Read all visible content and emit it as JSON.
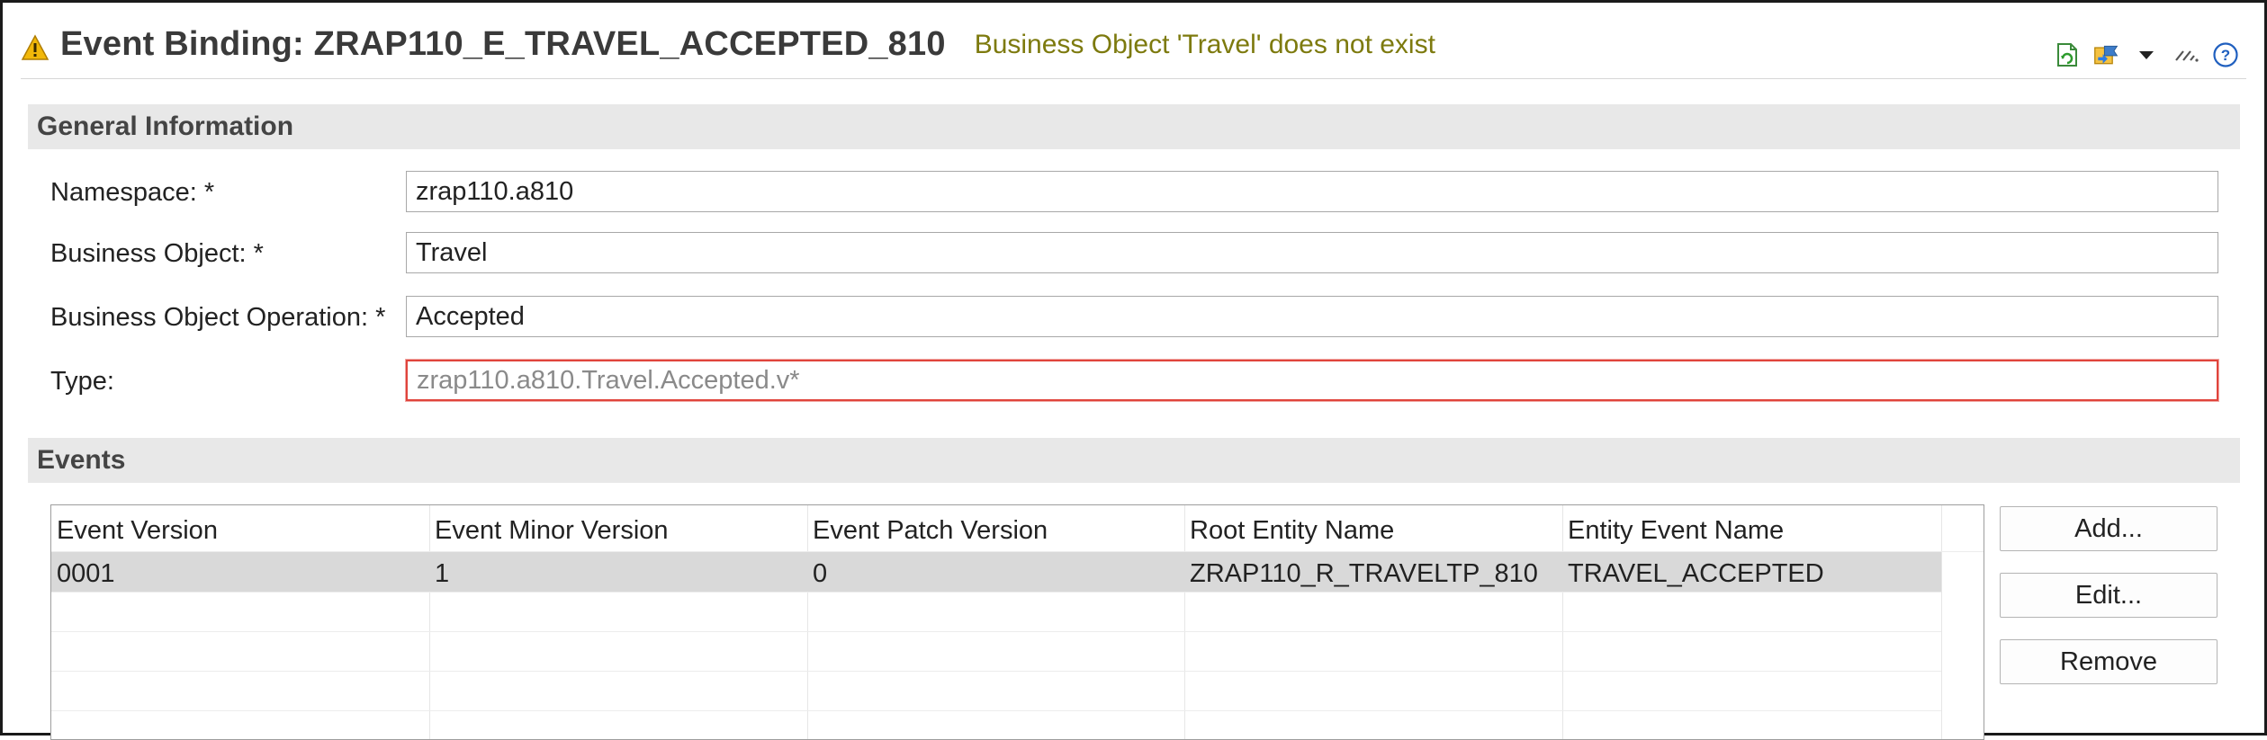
{
  "header": {
    "title": "Event Binding: ZRAP110_E_TRAVEL_ACCEPTED_810",
    "status_message": "Business Object 'Travel' does not exist",
    "status_color": "#7d7a0e",
    "warning_icon": "warning-icon",
    "toolbar_icons": [
      "refresh-document-icon",
      "publish-icon",
      "dropdown-arrow-icon",
      "link-icon",
      "help-icon"
    ]
  },
  "general": {
    "section_title": "General Information",
    "fields": [
      {
        "label": "Namespace: *",
        "value": "zrap110.a810",
        "placeholder": ""
      },
      {
        "label": "Business Object: *",
        "value": "Travel",
        "placeholder": ""
      },
      {
        "label": "Business Object Operation: *",
        "value": "Accepted",
        "placeholder": ""
      },
      {
        "label": "Type:",
        "value": "",
        "placeholder": "zrap110.a810.Travel.Accepted.v*",
        "error": true
      }
    ]
  },
  "events": {
    "section_title": "Events",
    "columns": [
      "Event Version",
      "Event Minor Version",
      "Event Patch Version",
      "Root Entity Name",
      "Entity Event Name"
    ],
    "rows": [
      [
        "0001",
        "1",
        "0",
        "ZRAP110_R_TRAVELTP_810",
        "TRAVEL_ACCEPTED"
      ]
    ],
    "buttons": {
      "add": "Add...",
      "edit": "Edit...",
      "remove": "Remove"
    }
  },
  "colors": {
    "error_border": "#e0443c",
    "section_bg": "#e8e8e8",
    "selected_row": "#d9d9d9"
  }
}
